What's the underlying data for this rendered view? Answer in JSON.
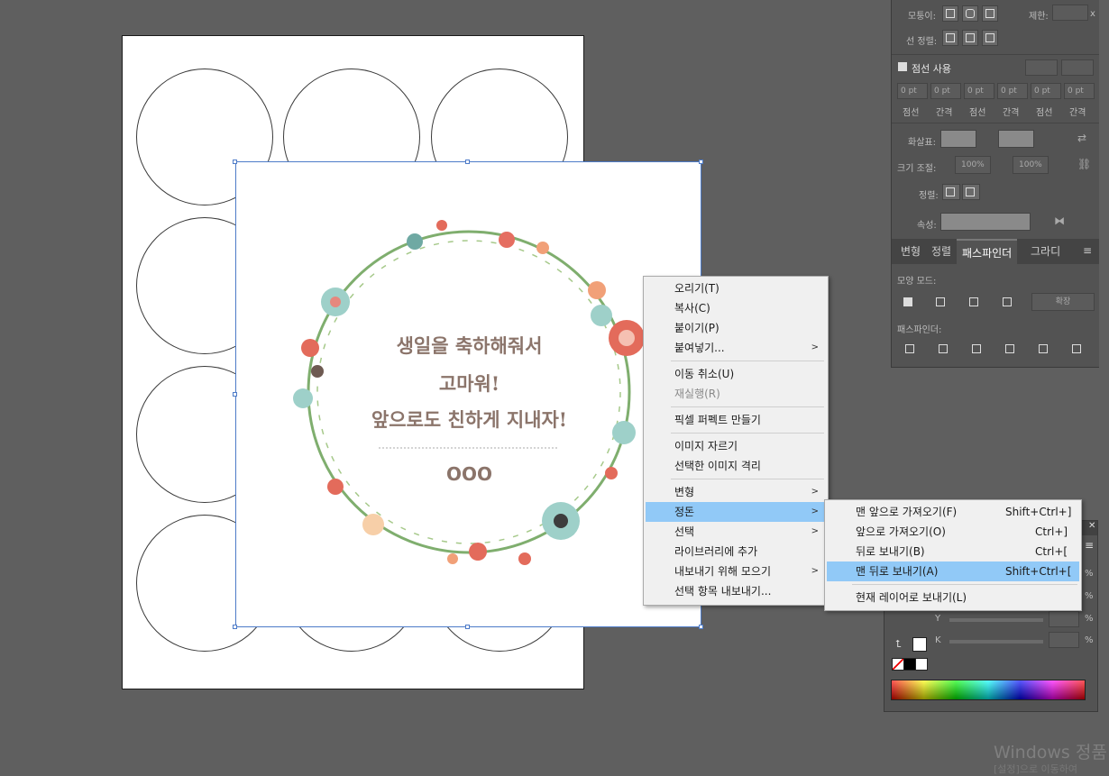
{
  "context_menu": {
    "items": [
      {
        "label": "오리기(T)"
      },
      {
        "label": "복사(C)"
      },
      {
        "label": "붙이기(P)"
      },
      {
        "label": "붙여넣기..."
      },
      {
        "label": "이동 취소(U)"
      },
      {
        "label": "재실행(R)"
      },
      {
        "label": "픽셀 퍼펙트 만들기"
      },
      {
        "label": "이미지 자르기"
      },
      {
        "label": "선택한 이미지 격리"
      },
      {
        "label": "변형"
      },
      {
        "label": "정돈"
      },
      {
        "label": "선택"
      },
      {
        "label": "라이브러리에 추가"
      },
      {
        "label": "내보내기 위해 모으기"
      },
      {
        "label": "선택 항목 내보내기..."
      }
    ]
  },
  "arrange_submenu": {
    "items": [
      {
        "label": "맨 앞으로 가져오기(F)",
        "shortcut": "Shift+Ctrl+]"
      },
      {
        "label": "앞으로 가져오기(O)",
        "shortcut": "Ctrl+]"
      },
      {
        "label": "뒤로 보내기(B)",
        "shortcut": "Ctrl+["
      },
      {
        "label": "맨 뒤로 보내기(A)",
        "shortcut": "Shift+Ctrl+["
      },
      {
        "label": "현재 레이어로 보내기(L)",
        "shortcut": ""
      }
    ]
  },
  "card": {
    "line1": "생일을 축하해줘서",
    "line2": "고마워!",
    "line3": "앞으로도 친하게 지내자!",
    "signature": "OOO"
  },
  "stroke_panel": {
    "corner_label": "모퉁이:",
    "limit_label": "제한:",
    "limit_unit": "x",
    "align_label": "선 정렬:",
    "dashed_label": "점선 사용",
    "dash_values": [
      "0 pt",
      "0 pt",
      "0 pt",
      "0 pt",
      "0 pt",
      "0 pt"
    ],
    "dash_labels": [
      "점선",
      "간격",
      "점선",
      "간격",
      "점선",
      "간격"
    ],
    "arrow_label": "화살표:",
    "scale_label": "크기 조절:",
    "scale_values": [
      "100%",
      "100%"
    ],
    "align2_label": "정렬:",
    "profile_label": "속성:"
  },
  "pathfinder_panel": {
    "tabs": [
      "변형",
      "정렬",
      "패스파인더",
      "그라디"
    ],
    "shape_modes_label": "모양 모드:",
    "expand_label": "확장",
    "pathfinders_label": "패스파인더:"
  },
  "color_panel": {
    "percent": "%",
    "channel_y": "Y",
    "channel_k": "K"
  },
  "watermark": {
    "line1": "Windows 정품",
    "line2": "[설정]으로 이동하여"
  }
}
